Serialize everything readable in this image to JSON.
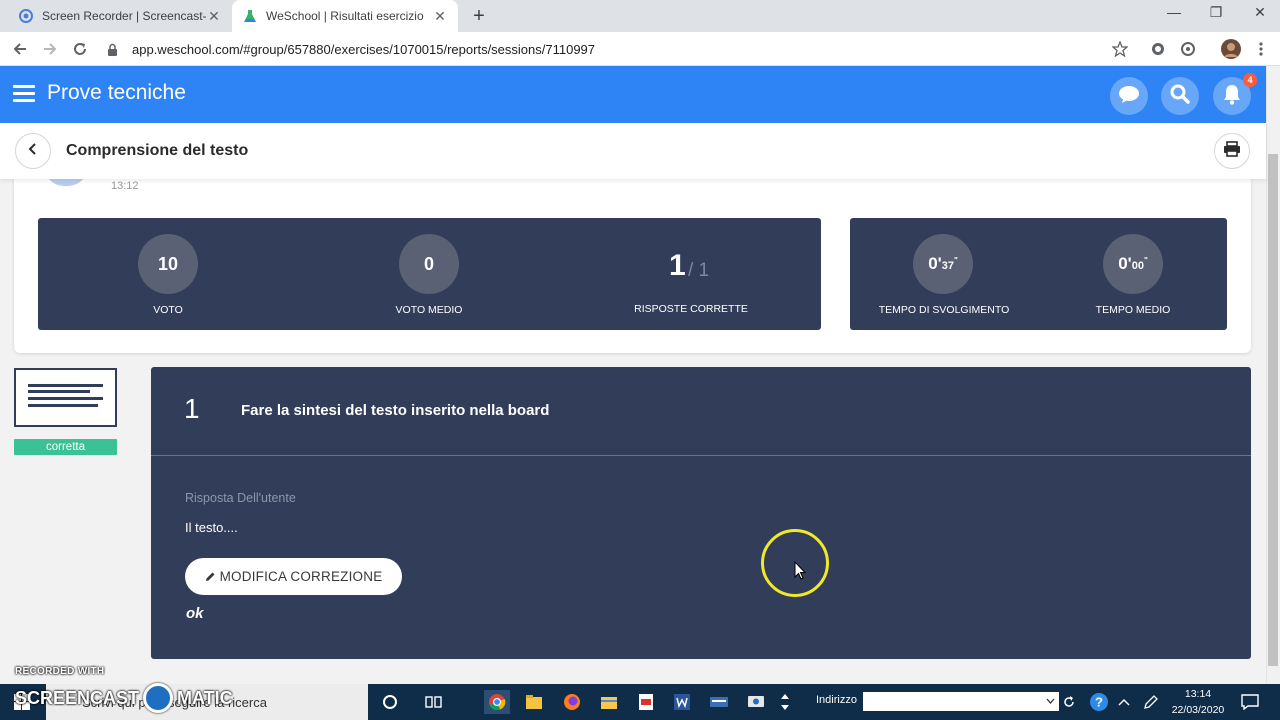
{
  "browser": {
    "tabs": [
      {
        "title": "Screen Recorder | Screencast-O-M",
        "active": false
      },
      {
        "title": "WeSchool | Risultati esercizio",
        "active": true
      }
    ],
    "url": "app.weschool.com/#group/657880/exercises/1070015/reports/sessions/7110997"
  },
  "app": {
    "title": "Prove tecniche",
    "notification_count": "4",
    "accent_color": "#2f84f5",
    "panel_color": "#323d5a"
  },
  "exercise": {
    "title": "Comprensione del testo",
    "time": "13:12"
  },
  "stats": {
    "voto": {
      "value": "10",
      "label": "VOTO"
    },
    "voto_medio": {
      "value": "0",
      "label": "VOTO MEDIO"
    },
    "risposte": {
      "correct": "1",
      "total": "/ 1",
      "label": "RISPOSTE CORRETTE"
    },
    "tempo_svolgimento": {
      "main": "0'",
      "sec": "37",
      "mark": "\"",
      "label": "TEMPO DI SVOLGIMENTO"
    },
    "tempo_medio": {
      "main": "0'",
      "sec": "00",
      "mark": "\"",
      "label": "TEMPO MEDIO"
    }
  },
  "question": {
    "status": "corretta",
    "status_color": "#3bc196",
    "number": "1",
    "text": "Fare la sintesi del testo inserito nella board",
    "answer_label": "Risposta Dell'utente",
    "answer": "Il testo....",
    "edit_button": "MODIFICA CORREZIONE",
    "comment": "ok"
  },
  "watermark": {
    "line1": "RECORDED WITH",
    "line2a": "SCREENCAST",
    "line2b": "MATIC"
  },
  "taskbar": {
    "search_placeholder": "Scrivi qui per eseguire la ricerca",
    "address_label": "Indirizzo",
    "time": "13:14",
    "date": "22/03/2020"
  }
}
